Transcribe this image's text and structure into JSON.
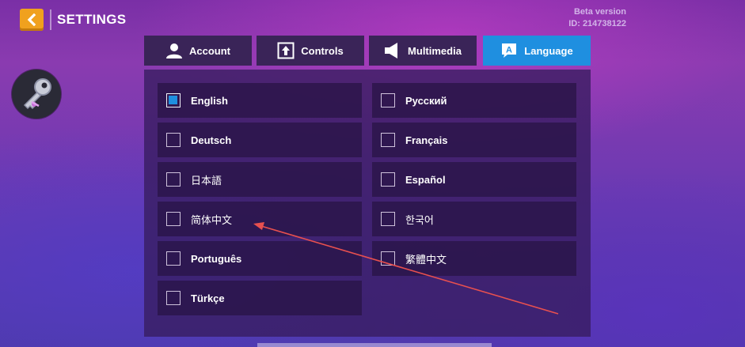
{
  "header": {
    "title": "SETTINGS",
    "version_label": "Beta version",
    "id_label": "ID: 214738122"
  },
  "tabs": [
    {
      "label": "Account",
      "icon": "person-icon",
      "active": false
    },
    {
      "label": "Controls",
      "icon": "arrow-up-box-icon",
      "active": false
    },
    {
      "label": "Multimedia",
      "icon": "speaker-icon",
      "active": false
    },
    {
      "label": "Language",
      "icon": "language-icon",
      "active": true
    }
  ],
  "languages": {
    "left": [
      {
        "label": "English",
        "checked": true
      },
      {
        "label": "Deutsch",
        "checked": false
      },
      {
        "label": "日本語",
        "checked": false
      },
      {
        "label": "简体中文",
        "checked": false
      },
      {
        "label": "Português",
        "checked": false
      },
      {
        "label": "Türkçe",
        "checked": false
      }
    ],
    "right": [
      {
        "label": "Русский",
        "checked": false
      },
      {
        "label": "Français",
        "checked": false
      },
      {
        "label": "Español",
        "checked": false
      },
      {
        "label": "한국어",
        "checked": false
      },
      {
        "label": "繁體中文",
        "checked": false
      }
    ]
  },
  "colors": {
    "accent": "#1f8fe0",
    "back_button": "#f0a11e",
    "annotation_arrow": "#e8504f"
  },
  "avatar_icon": "key-icon",
  "language_tab_glyph": "A"
}
